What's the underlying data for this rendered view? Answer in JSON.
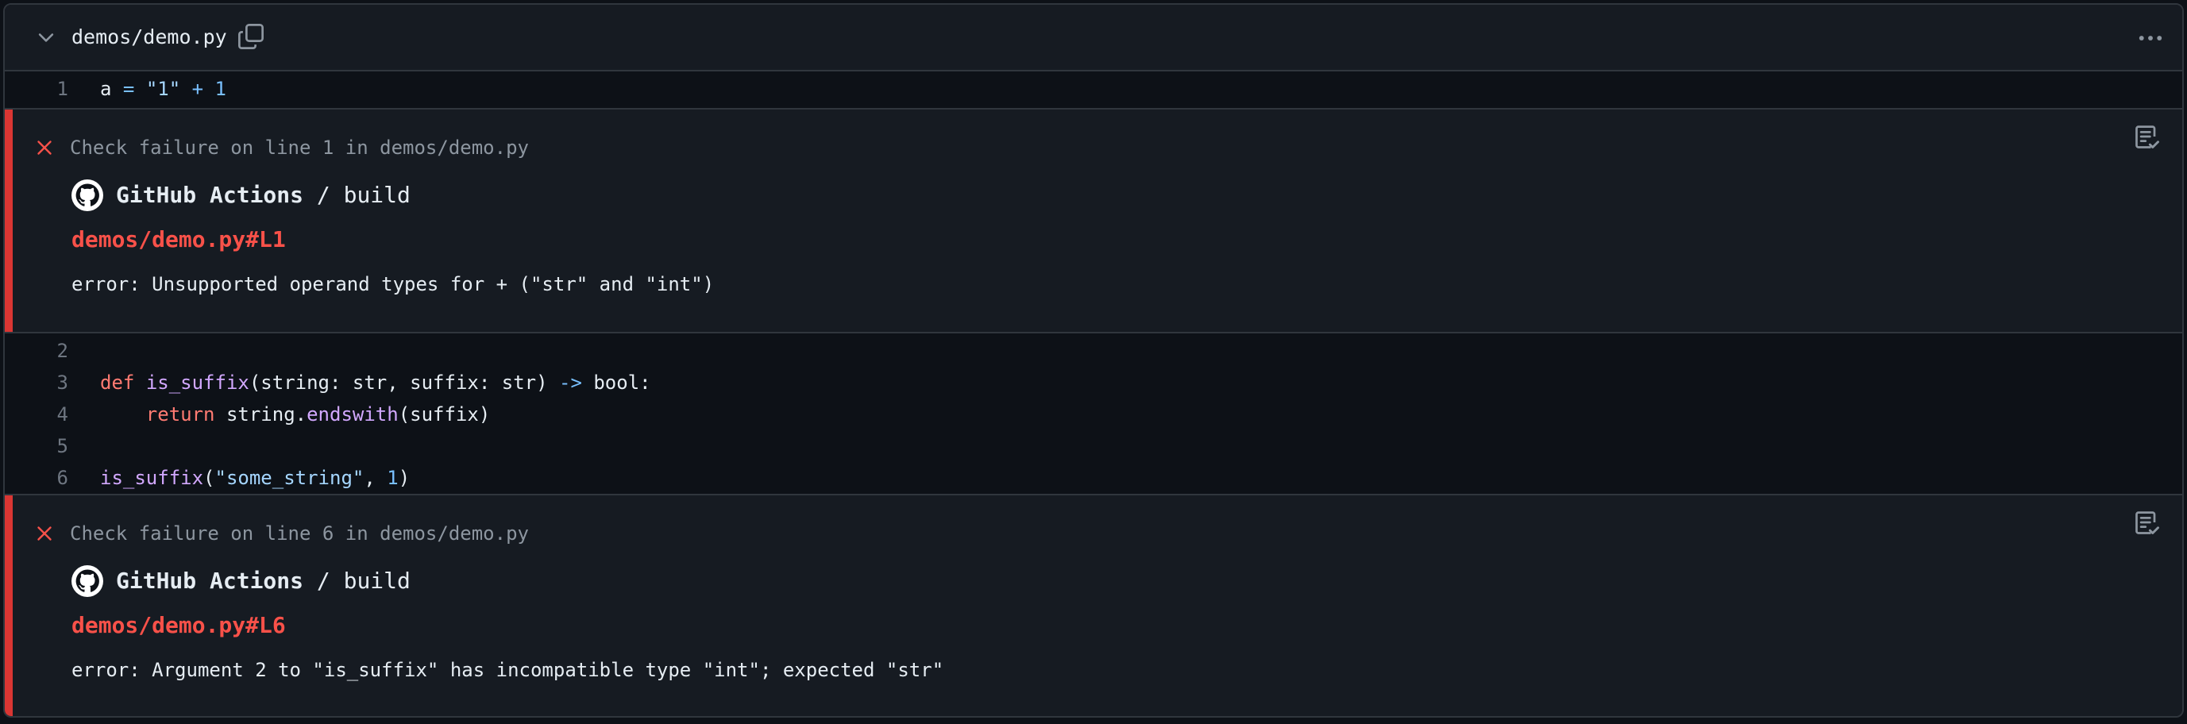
{
  "file": {
    "path": "demos/demo.py"
  },
  "code_lines": [
    {
      "num": "1",
      "text": "a = \"1\" + 1"
    },
    {
      "num": "2",
      "text": ""
    },
    {
      "num": "3",
      "text": "def is_suffix(string: str, suffix: str) -> bool:"
    },
    {
      "num": "4",
      "text": "    return string.endswith(suffix)"
    },
    {
      "num": "5",
      "text": ""
    },
    {
      "num": "6",
      "text": "is_suffix(\"some_string\", 1)"
    }
  ],
  "annotations": [
    {
      "title": "Check failure on line 1 in demos/demo.py",
      "app": "GitHub Actions",
      "job": " / build",
      "link": "demos/demo.py#L1",
      "message": "error: Unsupported operand types for + (\"str\" and \"int\")"
    },
    {
      "title": "Check failure on line 6 in demos/demo.py",
      "app": "GitHub Actions",
      "job": " / build",
      "link": "demos/demo.py#L6",
      "message": "error: Argument 2 to \"is_suffix\" has incompatible type \"int\"; expected \"str\""
    }
  ],
  "colors": {
    "background": "#0d1117",
    "header": "#161b22",
    "failure": "#da3633",
    "link": "#f85149",
    "keyword": "#ff7b72",
    "function": "#d2a8ff",
    "string": "#a5d6ff"
  }
}
